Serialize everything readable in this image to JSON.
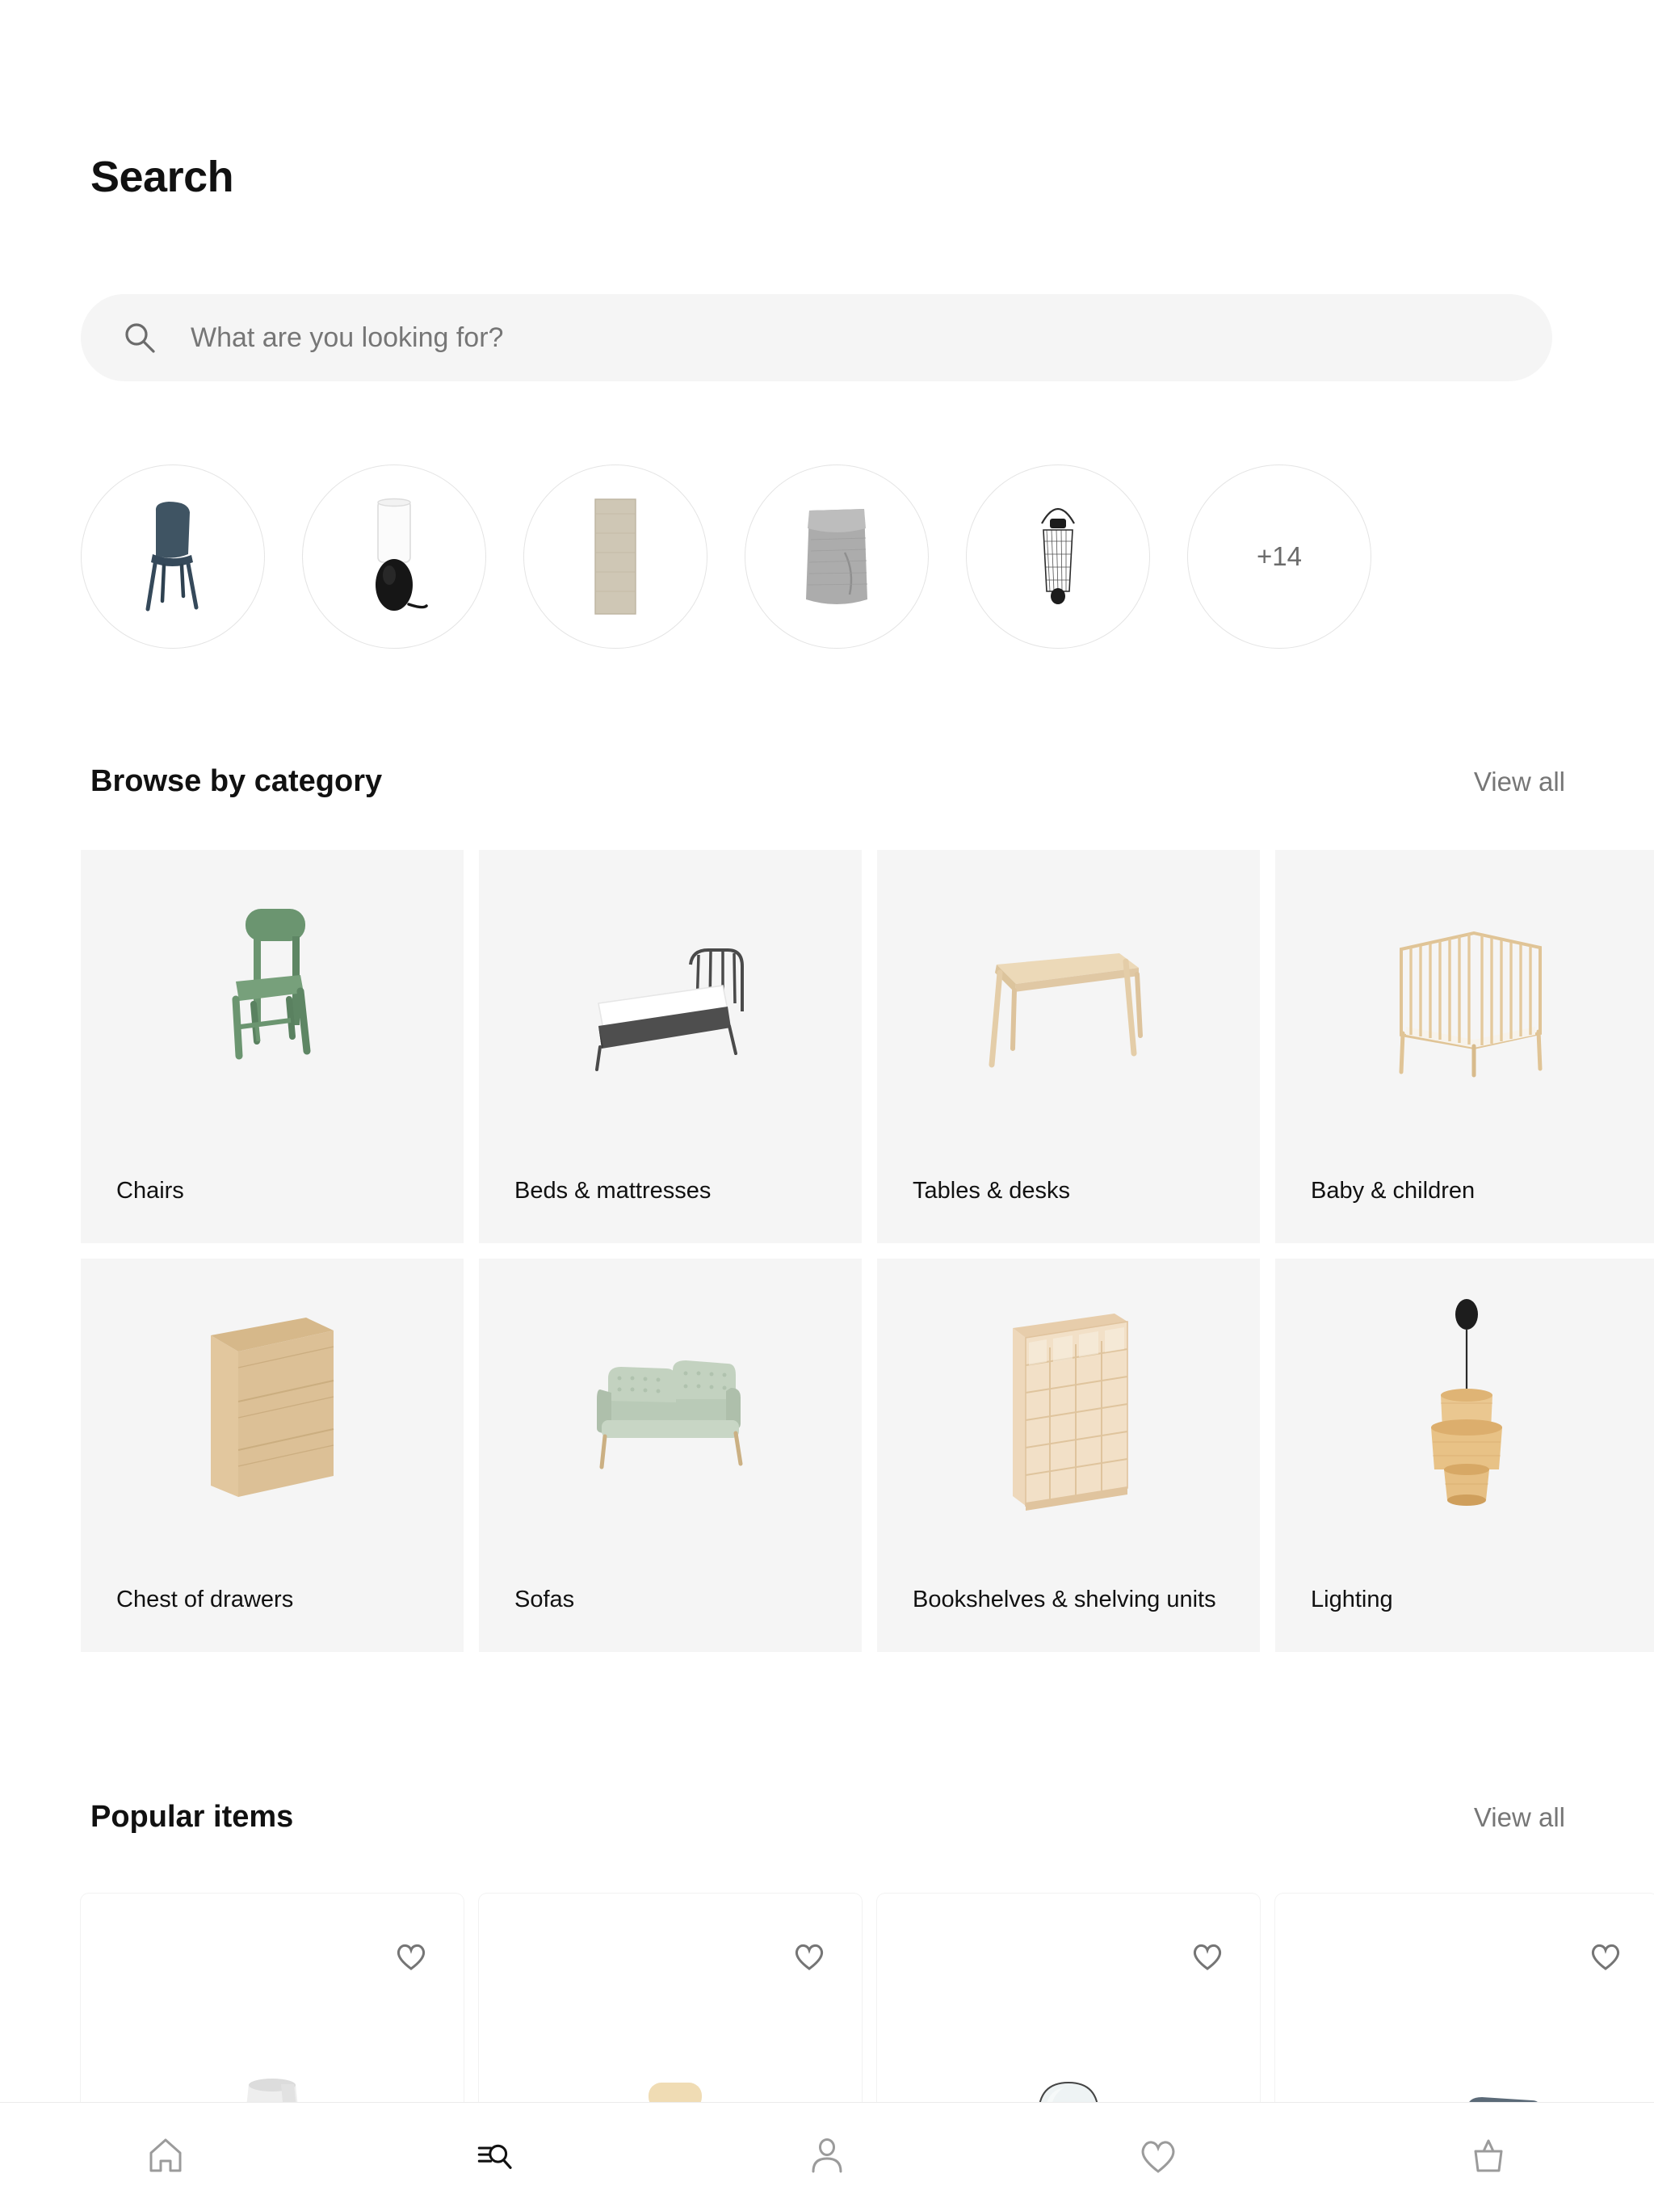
{
  "header": {
    "title": "Search"
  },
  "search": {
    "placeholder": "What are you looking for?",
    "icon": "search-icon"
  },
  "quick_circles": {
    "items": [
      {
        "name": "chair-thumbnail",
        "product": "dining chair",
        "color": "#3f5463"
      },
      {
        "name": "table-lamp-thumbnail",
        "product": "table lamp",
        "color": "#1a1a1a"
      },
      {
        "name": "rug-thumbnail",
        "product": "rug",
        "color": "#cfc6b4"
      },
      {
        "name": "throw-blanket-thumbnail",
        "product": "throw blanket",
        "color": "#a8a8a8"
      },
      {
        "name": "lantern-thumbnail",
        "product": "wire lantern",
        "color": "#2b2b2b"
      }
    ],
    "more_label": "+14"
  },
  "categories_section": {
    "title": "Browse by category",
    "view_all_label": "View all",
    "items": [
      {
        "label": "Chairs",
        "art": "chair",
        "color": "#5f8a63"
      },
      {
        "label": "Beds & mattresses",
        "art": "bed",
        "color": "#4a4a4a"
      },
      {
        "label": "Tables & desks",
        "art": "desk",
        "color": "#e8d5b5"
      },
      {
        "label": "Baby & children",
        "art": "crib",
        "color": "#e4c99d"
      },
      {
        "label": "Chest of drawers",
        "art": "dresser",
        "color": "#dec49a"
      },
      {
        "label": "Sofas",
        "art": "sofa",
        "color": "#b6c7b4"
      },
      {
        "label": "Bookshelves & shelving units",
        "art": "bookcase",
        "color": "#e8cfae"
      },
      {
        "label": "Lighting",
        "art": "pendant",
        "color": "#e0b878"
      }
    ]
  },
  "popular_section": {
    "title": "Popular items",
    "view_all_label": "View all",
    "items": [
      {
        "art": "lampshade",
        "color": "#e3e3e3",
        "favorite_icon": "heart-icon"
      },
      {
        "art": "wood-chair",
        "color": "#f0dcb4",
        "favorite_icon": "heart-icon"
      },
      {
        "art": "arch-mirror",
        "color": "#eef2f3",
        "favorite_icon": "heart-icon"
      },
      {
        "art": "blue-sofa",
        "color": "#54626f",
        "favorite_icon": "heart-icon"
      }
    ]
  },
  "bottom_nav": {
    "items": [
      {
        "name": "nav-home",
        "icon": "home-icon",
        "active": false
      },
      {
        "name": "nav-search",
        "icon": "search-list-icon",
        "active": true
      },
      {
        "name": "nav-profile",
        "icon": "person-icon",
        "active": false
      },
      {
        "name": "nav-favorites",
        "icon": "heart-icon",
        "active": false
      },
      {
        "name": "nav-cart",
        "icon": "shopping-bag-icon",
        "active": false
      }
    ],
    "active_color": "#111111",
    "inactive_color": "#9b9b9b"
  },
  "theme": {
    "background": "#ffffff",
    "card_background": "#f5f5f5",
    "input_background": "#f5f5f5",
    "text_primary": "#111111",
    "text_secondary": "#767676",
    "border": "#e4e4e4"
  }
}
